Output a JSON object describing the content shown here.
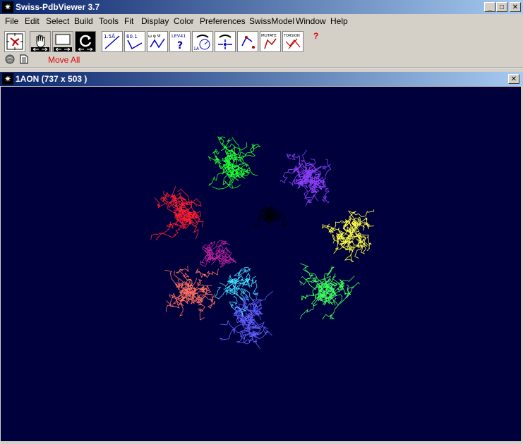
{
  "window": {
    "title": "Swiss-PdbViewer 3.7",
    "app_icon": "spdbv-icon",
    "controls": {
      "minimize": "_",
      "maximize": "□",
      "close": "✕"
    }
  },
  "menu": [
    {
      "label": "File"
    },
    {
      "label": "Edit"
    },
    {
      "label": "Select"
    },
    {
      "label": "Build"
    },
    {
      "label": "Tools"
    },
    {
      "label": "Fit"
    },
    {
      "label": "Display"
    },
    {
      "label": "Color"
    },
    {
      "label": "Preferences"
    },
    {
      "label": "SwissModel"
    },
    {
      "label": "Window"
    },
    {
      "label": "Help"
    }
  ],
  "toolbar": {
    "dist_label": "1.5Å",
    "angle_label": "60.1",
    "dihedral_label": "ω φ Ψ",
    "lev_label": "LEV41",
    "center_label": "1A",
    "mutate_label": "MUTATE",
    "torsion_label": "TORSION",
    "help_label": "?",
    "move_all_label": "Move All",
    "colors": {
      "move_all": "#e00000"
    }
  },
  "viewer": {
    "title": "1AON  (737 x 503 )",
    "close": "✕",
    "background": "#00003c",
    "subunit_colors": [
      "#ff2030",
      "#20ff30",
      "#9040ff",
      "#ffff40",
      "#40ff60",
      "#6060ff",
      "#ff7060",
      "#40e0ff",
      "#c020a0",
      "#000000"
    ]
  }
}
